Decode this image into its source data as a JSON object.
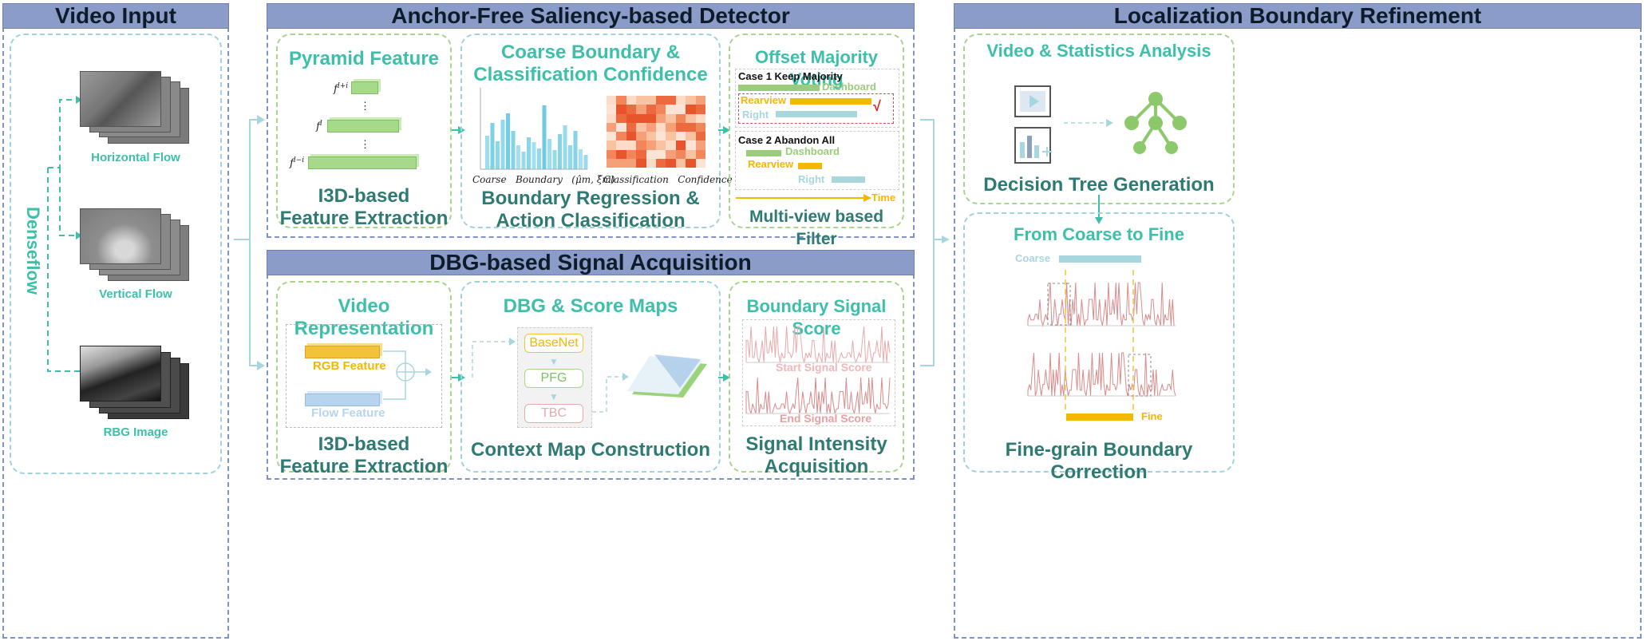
{
  "sections": {
    "video_input": "Video Input",
    "detector": "Anchor-Free Saliency-based Detector",
    "dbg": "DBG-based Signal Acquisition",
    "refine": "Localization Boundary Refinement"
  },
  "video_input": {
    "side_label": "Denseflow",
    "horizontal": "Horizontal Flow",
    "vertical": "Vertical Flow",
    "rgb": "RBG Image"
  },
  "pyramid": {
    "title": "Pyramid Feature",
    "f_top": "f",
    "f_top_sup": "l+i",
    "f_mid": "f",
    "f_mid_sup": "l",
    "f_bot": "f",
    "f_bot_sup": "l−i",
    "dots": "⋮",
    "caption": "I3D-based\nFeature Extraction"
  },
  "coarse": {
    "title": "Coarse Boundary &\nClassification Confidence",
    "bar_caption": "Coarse   Boundary   (μ̂m, ξ̂m)",
    "heat_caption": "Classification   Confidence",
    "caption": "Boundary Regression &\nAction Classification"
  },
  "voting": {
    "title": "Offset Majority Voting",
    "case1": "Case 1 Keep Majority",
    "case2": "Case 2 Abandon All",
    "dashboard": "Dashboard",
    "rearview": "Rearview",
    "right": "Right",
    "check": "√",
    "time": "Time",
    "caption": "Multi-view based Filter"
  },
  "video_rep": {
    "title": "Video Representation",
    "rgb": "RGB Feature",
    "flow": "Flow Feature",
    "caption": "I3D-based\nFeature Extraction"
  },
  "dbg_maps": {
    "title": "DBG & Score Maps",
    "basenet": "BaseNet",
    "pfg": "PFG",
    "tbc": "TBC",
    "caption": "Context Map Construction"
  },
  "signal": {
    "title": "Boundary Signal Score",
    "start": "Start Signal Score",
    "end": "End Signal Score",
    "caption": "Signal Intensity\nAcquisition"
  },
  "analysis": {
    "title": "Video & Statistics Analysis",
    "caption": "Decision Tree Generation"
  },
  "coarse_fine": {
    "title": "From Coarse to Fine",
    "coarse": "Coarse",
    "fine": "Fine",
    "caption": "Fine-grain Boundary Correction"
  },
  "chart_data": {
    "type": "bar",
    "title": "",
    "series": [
      {
        "values": [
          42,
          58,
          35,
          62,
          70,
          48,
          30,
          22,
          40,
          34,
          26,
          80,
          38,
          24,
          44,
          55,
          30,
          48,
          25,
          18
        ]
      }
    ],
    "ylim": [
      0,
      100
    ]
  },
  "colors": {
    "section_header": "#8b9cc8",
    "title_teal": "#3dbfa9",
    "caption_teal": "#2f7a73",
    "dashboard_green": "#9bcb7c",
    "rearview_yellow": "#f5b800",
    "right_teal": "#a8d8dc",
    "rgb_yellow": "#f2c33a",
    "flow_blue": "#b7d4ef",
    "signal_red": "#e8a9a9"
  }
}
